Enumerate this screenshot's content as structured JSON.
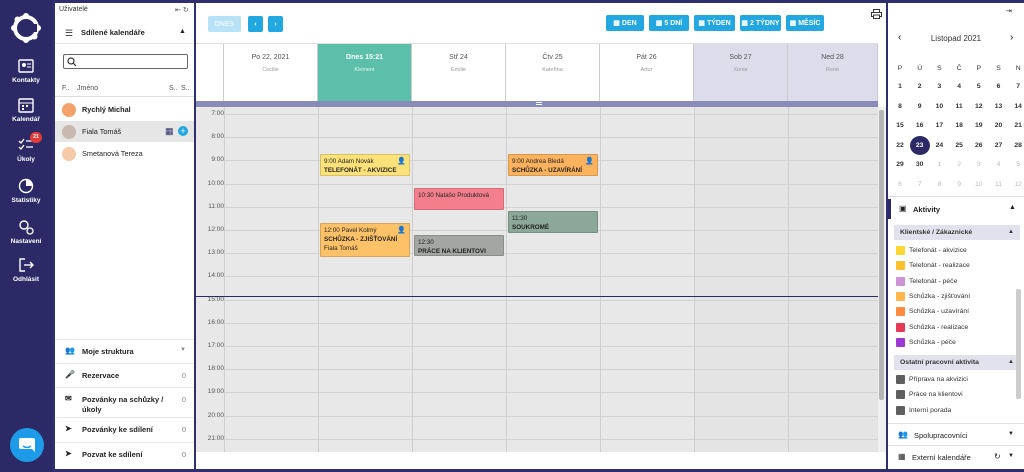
{
  "rail": {
    "items": [
      {
        "label": "Kontakty",
        "icon": "contacts-icon"
      },
      {
        "label": "Kalendář",
        "icon": "calendar-icon"
      },
      {
        "label": "Úkoly",
        "icon": "tasks-icon",
        "badge": "21"
      },
      {
        "label": "Statistiky",
        "icon": "stats-icon"
      },
      {
        "label": "Nastavení",
        "icon": "settings-icon"
      },
      {
        "label": "Odhlásit",
        "icon": "logout-icon"
      }
    ]
  },
  "users": {
    "header": "Uživatelé",
    "shared_calendars": "Sdílené kalendáře",
    "search_value": "",
    "cols": {
      "f": "F..",
      "name": "Jméno",
      "s1": "S..",
      "s2": "S.."
    },
    "list": [
      {
        "name": "Rychlý Michal",
        "bold": true
      },
      {
        "name": "Fiala Tomáš",
        "bold": false,
        "selected": true
      },
      {
        "name": "Smetanová Tereza",
        "bold": false
      }
    ],
    "bottom": [
      {
        "label": "Moje struktura",
        "value": ""
      },
      {
        "label": "Rezervace",
        "value": "0"
      },
      {
        "label": "Pozvánky na schůzky / úkoly",
        "value": "0"
      },
      {
        "label": "Pozvánky ke sdílení",
        "value": "0"
      },
      {
        "label": "Pozvat ke sdílení",
        "value": "0"
      }
    ]
  },
  "toolbar": {
    "today": "DNES",
    "views": [
      "DEN",
      "5 DNÍ",
      "TÝDEN",
      "2 TÝDNY",
      "MĚSÍC"
    ]
  },
  "days": [
    {
      "date": "Po 22, 2021",
      "name": "Cecilie"
    },
    {
      "date": "Dnes 15:21",
      "name": "Klement",
      "today": true
    },
    {
      "date": "Stř 24",
      "name": "Emilie"
    },
    {
      "date": "Čtv 25",
      "name": "Kateřina"
    },
    {
      "date": "Pát 26",
      "name": "Artur"
    },
    {
      "date": "Sob 27",
      "name": "Xenie",
      "weekend": true
    },
    {
      "date": "Ned 28",
      "name": "René",
      "weekend": true
    }
  ],
  "hours": [
    "7:00",
    "8:00",
    "9:00",
    "10:00",
    "11:00",
    "12:00",
    "13:00",
    "14:00",
    "15:00",
    "16:00",
    "17:00",
    "18:00",
    "19:00",
    "20:00",
    "21:00"
  ],
  "events": [
    {
      "day": 1,
      "time": "9:00 Adam Novák",
      "title": "TELEFONÁT - AKVIZICE",
      "color": "#fde27a",
      "person": true
    },
    {
      "day": 1,
      "time": "12:00 Pavel Kolmý",
      "title": "SCHŮZKA - ZJIŠŤOVÁNÍ",
      "extra": "Fiala Tomáš",
      "color": "#fdc267",
      "person": true
    },
    {
      "day": 2,
      "time": "10:30 Natašo Produktová",
      "title": "",
      "color": "#f47f8c",
      "person": false
    },
    {
      "day": 2,
      "time": "12:30",
      "title": "PRÁCE NA KLIENTOVI",
      "color": "#a3a6a3",
      "person": false
    },
    {
      "day": 3,
      "time": "9:00 Andrea Bledá",
      "title": "SCHŮZKA - UZAVÍRÁNÍ",
      "color": "#fdb25e",
      "person": true
    },
    {
      "day": 3,
      "time": "11:30",
      "title": "SOUKROMÉ",
      "color": "#8ba89a",
      "person": false
    }
  ],
  "minical": {
    "month": "Listopad 2021",
    "weekdays": [
      "P",
      "Ú",
      "S",
      "Č",
      "P",
      "S",
      "N"
    ],
    "weeks": [
      [
        "1",
        "2",
        "3",
        "4",
        "5",
        "6",
        "7"
      ],
      [
        "8",
        "9",
        "10",
        "11",
        "12",
        "13",
        "14"
      ],
      [
        "15",
        "16",
        "17",
        "18",
        "19",
        "20",
        "21"
      ],
      [
        "22",
        "23",
        "24",
        "25",
        "26",
        "27",
        "28"
      ],
      [
        "29",
        "30",
        "1",
        "2",
        "3",
        "4",
        "5"
      ],
      [
        "6",
        "7",
        "8",
        "9",
        "10",
        "11",
        "12"
      ]
    ]
  },
  "activities": {
    "title": "Aktivity",
    "client_header": "Klientské / Zákaznické",
    "client": [
      {
        "label": "Telefonát - akvizice",
        "color": "#fdd835"
      },
      {
        "label": "Telefonát - realizace",
        "color": "#fbc02d"
      },
      {
        "label": "Telefonát - péče",
        "color": "#ce93d8"
      },
      {
        "label": "Schůzka - zjišťování",
        "color": "#ffb74d"
      },
      {
        "label": "Schůzka - uzavírání",
        "color": "#ff8a3d"
      },
      {
        "label": "Schůzka - realizace",
        "color": "#e53957"
      },
      {
        "label": "Schůzka - péče",
        "color": "#9c3ad6"
      }
    ],
    "other_header": "Ostatní pracovní aktivita",
    "other": [
      {
        "label": "Příprava na akvizici",
        "color": "#5f5f5f"
      },
      {
        "label": "Práce na klientovi",
        "color": "#5f5f5f"
      },
      {
        "label": "Interní porada",
        "color": "#5f5f5f"
      }
    ],
    "collaborators": "Spolupracovníci",
    "external": "Externí kalendáře"
  }
}
